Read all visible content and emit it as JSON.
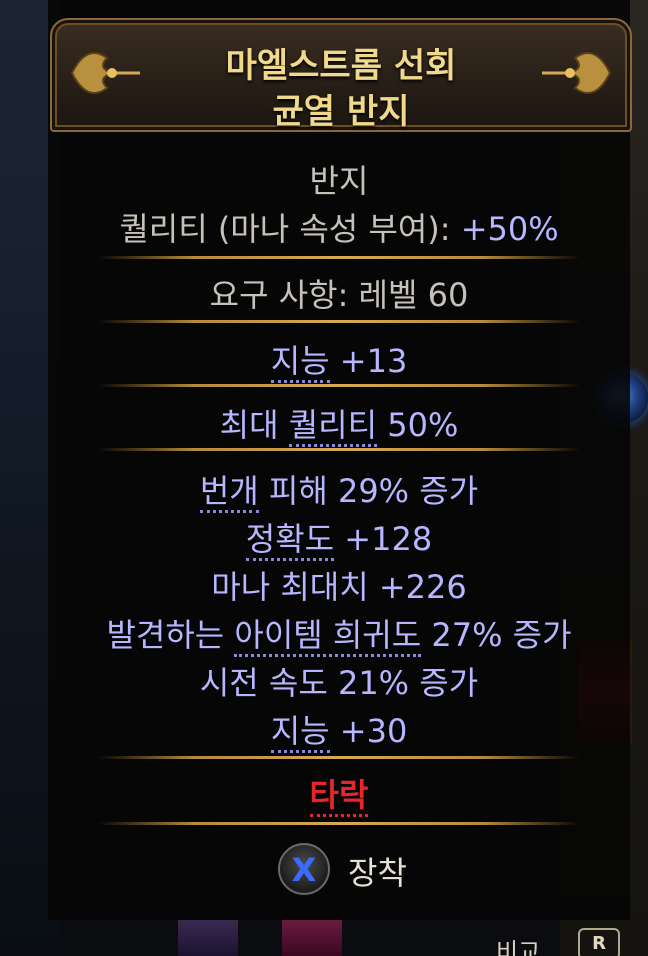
{
  "item": {
    "name_line1": "마엘스트롬 선회",
    "name_line2": "균열 반지",
    "type": "반지",
    "quality_label": "퀄리티 (마나 속성 부여): ",
    "quality_value": "+50%",
    "requirement": "요구 사항: 레벨 60",
    "implicit": {
      "kw": "지능",
      "rest": " +13"
    },
    "max_quality": {
      "pre": "최대 ",
      "kw": "퀄리티",
      "rest": " 50%"
    },
    "mods": [
      {
        "kw": "번개",
        "rest": " 피해 29% 증가"
      },
      {
        "kw": "정확도",
        "rest": " +128"
      },
      {
        "pre": "마나 최대치 +226"
      },
      {
        "pre": "발견하는 ",
        "kw": "아이템 희귀도",
        "rest": " 27% 증가"
      },
      {
        "pre": "시전 속도 21% 증가"
      },
      {
        "kw": "지능",
        "rest": " +30"
      }
    ],
    "corrupted": "타락"
  },
  "actions": {
    "equip_button_glyph": "X",
    "equip_label": "장착"
  },
  "background": {
    "compare_label": "비교",
    "compare_key": "R"
  },
  "colors": {
    "title": "#f0d98a",
    "mod": "#b7b6ff",
    "corrupted": "#e8262a",
    "separator": "#d8aa50"
  }
}
